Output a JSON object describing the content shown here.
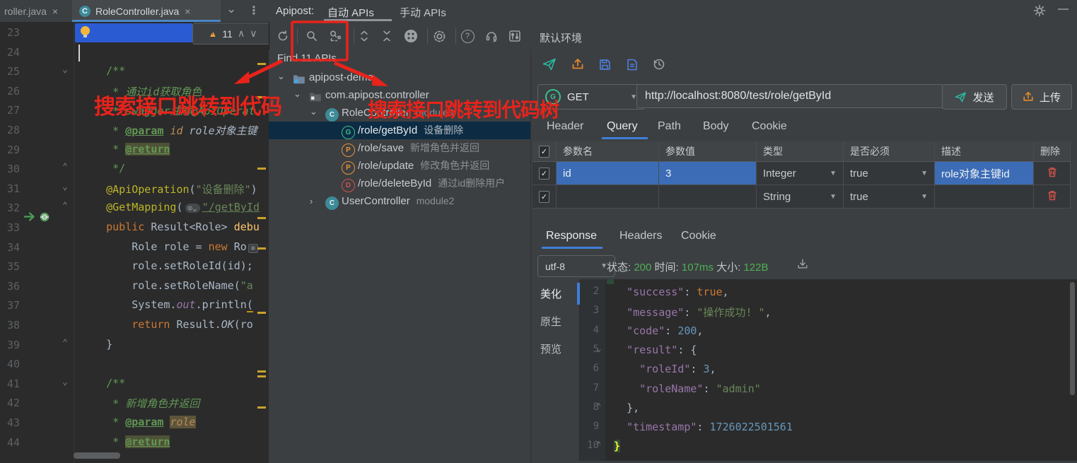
{
  "icons": {
    "close": "×",
    "dropdown": "▼",
    "check": "✓",
    "chevron_down": "⌄",
    "chevron_up": "⌃",
    "chevron_right": "›",
    "kebab": "⋮",
    "minimize": "—",
    "question": "?",
    "warning": "▲",
    "warn_mark": "!",
    "arrow_up_small": "∧",
    "arrow_down_small": "∨",
    "method_letters": {
      "get": "G",
      "post": "P",
      "del": "D",
      "class": "C"
    }
  },
  "editor_tabs": {
    "tab_partial": {
      "label": "roller.java"
    },
    "tab_active": {
      "label": "RoleController.java",
      "icon_letter": "C"
    }
  },
  "apipost_header": {
    "title": "Apipost:",
    "tabs": [
      {
        "label": "自动 APIs",
        "active": true
      },
      {
        "label": "手动 APIs",
        "active": false
      }
    ],
    "environment": "默认环境"
  },
  "inspection": {
    "warning_count": "11"
  },
  "editor": {
    "lines": [
      {
        "n": "23",
        "seg": []
      },
      {
        "n": "24",
        "seg": []
      },
      {
        "n": "25",
        "fold": "⌄",
        "seg": [
          [
            "    /**",
            "cm"
          ]
        ]
      },
      {
        "n": "26",
        "seg": [
          [
            "     * ",
            "cm"
          ],
          [
            "通过id获取角色",
            "cmi"
          ]
        ]
      },
      {
        "n": "27",
        "seg": [
          [
            "     * ",
            "cm"
          ],
          [
            "swagger注解@ApiOperat.",
            "cmi"
          ]
        ]
      },
      {
        "n": "28",
        "seg": [
          [
            "     * ",
            "cm"
          ],
          [
            "@param",
            "tag"
          ],
          [
            " ",
            "cm"
          ],
          [
            "id",
            "prm"
          ],
          [
            " ",
            "cm"
          ],
          [
            "role对象主键",
            "docp"
          ]
        ]
      },
      {
        "n": "29",
        "seg": [
          [
            "     * ",
            "cm"
          ],
          [
            "@return",
            "tag hlret"
          ]
        ]
      },
      {
        "n": "30",
        "fold": "⌃",
        "seg": [
          [
            "     */",
            "cm"
          ]
        ]
      },
      {
        "n": "31",
        "fold": "⌄",
        "seg": [
          [
            "    ",
            "pln"
          ],
          [
            "@ApiOperation",
            "ann"
          ],
          [
            "(",
            "pln"
          ],
          [
            "\"设备删除\"",
            "str"
          ],
          [
            ")",
            "pln"
          ]
        ]
      },
      {
        "n": "32",
        "fold": "⌃",
        "seg": [
          [
            "    ",
            "pln"
          ],
          [
            "@GetMapping",
            "ann"
          ],
          [
            "(",
            "pln"
          ],
          [
            "⊙⌄",
            "inlay"
          ],
          [
            "\"/getById",
            "strU"
          ]
        ]
      },
      {
        "n": "33",
        "run": true,
        "seg": [
          [
            "    ",
            "pln"
          ],
          [
            "public ",
            "kw"
          ],
          [
            "Result<Role> ",
            "pln"
          ],
          [
            "debu",
            "mth"
          ]
        ]
      },
      {
        "n": "34",
        "seg": [
          [
            "        Role role = ",
            "pln"
          ],
          [
            "new ",
            "kw"
          ],
          [
            "Ro",
            "pln"
          ],
          [
            "≡",
            "foldbox"
          ]
        ]
      },
      {
        "n": "35",
        "seg": [
          [
            "        role.setRoleId(id);",
            "pln"
          ]
        ]
      },
      {
        "n": "36",
        "seg": [
          [
            "        role.setRoleName(",
            "pln"
          ],
          [
            "\"a",
            "str"
          ]
        ]
      },
      {
        "n": "37",
        "seg": [
          [
            "        System.",
            "pln"
          ],
          [
            "out",
            "fld"
          ],
          [
            ".println",
            "pln"
          ],
          [
            "(",
            "warnul"
          ]
        ]
      },
      {
        "n": "38",
        "seg": [
          [
            "        ",
            "pln"
          ],
          [
            "return ",
            "kw"
          ],
          [
            "Result.",
            "pln"
          ],
          [
            "OK",
            "mthit"
          ],
          [
            "(ro",
            "pln"
          ]
        ]
      },
      {
        "n": "39",
        "fold": "⌃",
        "seg": [
          [
            "    }",
            "pln"
          ]
        ]
      },
      {
        "n": "40",
        "seg": []
      },
      {
        "n": "41",
        "fold": "⌄",
        "seg": [
          [
            "    /**",
            "cm"
          ]
        ]
      },
      {
        "n": "42",
        "seg": [
          [
            "     * ",
            "cm"
          ],
          [
            "新增角色并返回",
            "cmi"
          ]
        ]
      },
      {
        "n": "43",
        "seg": [
          [
            "     * ",
            "cm"
          ],
          [
            "@param",
            "tag"
          ],
          [
            " ",
            "cm"
          ],
          [
            "role",
            "prm hlrole"
          ]
        ]
      },
      {
        "n": "44",
        "seg": [
          [
            "     * ",
            "cm"
          ],
          [
            "@return",
            "tag hlret"
          ]
        ]
      }
    ]
  },
  "tree": {
    "header": "Find 11 APIs",
    "items": [
      {
        "level": 0,
        "expander": "open",
        "icon": "folder-blue",
        "label": "apipost-demo",
        "suffix": ""
      },
      {
        "level": 1,
        "expander": "open",
        "icon": "folder",
        "label": "com.apipost.controller",
        "suffix": ""
      },
      {
        "level": 2,
        "expander": "open",
        "icon": "class",
        "label": "RoleController",
        "suffix": "module3"
      },
      {
        "level": 3,
        "expander": "",
        "icon": "get",
        "label": "/role/getById",
        "suffix": "设备删除",
        "selected": true
      },
      {
        "level": 3,
        "expander": "",
        "icon": "post",
        "label": "/role/save",
        "suffix": "新增角色并返回"
      },
      {
        "level": 3,
        "expander": "",
        "icon": "post",
        "label": "/role/update",
        "suffix": "修改角色并返回"
      },
      {
        "level": 3,
        "expander": "",
        "icon": "del",
        "label": "/role/deleteById",
        "suffix": "通过id删除用户"
      },
      {
        "level": 2,
        "expander": "closed",
        "icon": "class",
        "label": "UserController",
        "suffix": "module2"
      }
    ]
  },
  "annotations": {
    "left_label": "搜索接口跳转到代码",
    "right_label": "搜索接口跳转到代码树",
    "color": "#e8231b"
  },
  "request": {
    "method": "GET",
    "url": "http://localhost:8080/test/role/getById",
    "send_label": "发送",
    "upload_label": "上传",
    "tabs": [
      {
        "label": "Header",
        "active": false
      },
      {
        "label": "Query",
        "active": true
      },
      {
        "label": "Path",
        "active": false
      },
      {
        "label": "Body",
        "active": false
      },
      {
        "label": "Cookie",
        "active": false
      }
    ]
  },
  "params_table": {
    "headers": [
      "参数名",
      "参数值",
      "类型",
      "是否必须",
      "描述",
      "删除"
    ],
    "rows": [
      {
        "checked": true,
        "name": "id",
        "value": "3",
        "type": "Integer",
        "required": "true",
        "desc": "role对象主键id",
        "selected": true
      },
      {
        "checked": true,
        "name": "",
        "value": "",
        "type": "String",
        "required": "true",
        "desc": "",
        "selected": false
      }
    ]
  },
  "response": {
    "tabs": [
      {
        "label": "Response",
        "active": true
      },
      {
        "label": "Headers",
        "active": false
      },
      {
        "label": "Cookie",
        "active": false
      }
    ],
    "encoding": "utf-8",
    "status_label": "状态:",
    "status_value": "200",
    "time_label": "时间:",
    "time_value": "107ms",
    "size_label": "大小:",
    "size_value": "122B",
    "view_tabs": [
      {
        "label": "美化",
        "active": true
      },
      {
        "label": "原生",
        "active": false
      },
      {
        "label": "预览",
        "active": false
      }
    ],
    "json_lines": [
      {
        "n": "2",
        "fold": "",
        "seg": [
          [
            "  ",
            "jp"
          ],
          [
            "\"success\"",
            "jk"
          ],
          [
            ": ",
            "jp"
          ],
          [
            "true",
            "jo"
          ],
          [
            ",",
            "jp"
          ]
        ]
      },
      {
        "n": "3",
        "fold": "",
        "seg": [
          [
            "  ",
            "jp"
          ],
          [
            "\"message\"",
            "jk"
          ],
          [
            ": ",
            "jp"
          ],
          [
            "\"操作成功! \"",
            "js"
          ],
          [
            ",",
            "jp"
          ]
        ]
      },
      {
        "n": "4",
        "fold": "",
        "seg": [
          [
            "  ",
            "jp"
          ],
          [
            "\"code\"",
            "jk"
          ],
          [
            ": ",
            "jp"
          ],
          [
            "200",
            "jn"
          ],
          [
            ",",
            "jp"
          ]
        ]
      },
      {
        "n": "5",
        "fold": "⌄",
        "seg": [
          [
            "  ",
            "jp"
          ],
          [
            "\"result\"",
            "jk"
          ],
          [
            ": ",
            "jp"
          ],
          [
            "{",
            "jb"
          ]
        ]
      },
      {
        "n": "6",
        "fold": "",
        "seg": [
          [
            "    ",
            "jp"
          ],
          [
            "\"roleId\"",
            "jk"
          ],
          [
            ": ",
            "jp"
          ],
          [
            "3",
            "jn"
          ],
          [
            ",",
            "jp"
          ]
        ]
      },
      {
        "n": "7",
        "fold": "",
        "seg": [
          [
            "    ",
            "jp"
          ],
          [
            "\"roleName\"",
            "jk"
          ],
          [
            ": ",
            "jp"
          ],
          [
            "\"admin\"",
            "js"
          ]
        ]
      },
      {
        "n": "8",
        "fold": "⌃",
        "seg": [
          [
            "  ",
            "jp"
          ],
          [
            "},",
            "jb"
          ]
        ]
      },
      {
        "n": "9",
        "fold": "",
        "seg": [
          [
            "  ",
            "jp"
          ],
          [
            "\"timestamp\"",
            "jk"
          ],
          [
            ": ",
            "jp"
          ],
          [
            "1726022501561",
            "jn"
          ]
        ]
      },
      {
        "n": "10",
        "fold": "⌃",
        "seg": [
          [
            "}",
            "jy"
          ]
        ]
      }
    ]
  }
}
